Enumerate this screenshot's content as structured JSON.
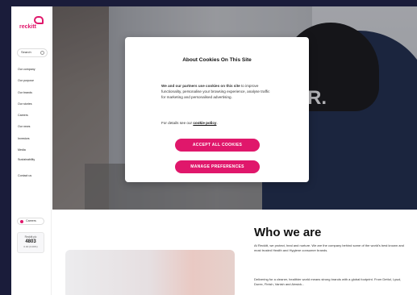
{
  "brand": {
    "name": "reckitt",
    "accent": "#e0176b"
  },
  "sidebar": {
    "search_label": "Search",
    "items": [
      {
        "label": "Our company"
      },
      {
        "label": "Our purpose"
      },
      {
        "label": "Our brands"
      },
      {
        "label": "Our stories"
      },
      {
        "label": "Careers"
      },
      {
        "label": "Our news"
      },
      {
        "label": "Investors"
      },
      {
        "label": "Media"
      },
      {
        "label": "Sustainability"
      },
      {
        "label": "Contact us"
      }
    ],
    "careers_label": "Careers",
    "stock": {
      "label": "Reckitt plc",
      "value": "4803",
      "change": "0.00 (0.00%)"
    }
  },
  "hero": {
    "headline": "ER."
  },
  "modal": {
    "title": "About Cookies On This Site",
    "body_bold": "We and our partners use cookies on this site",
    "body_rest": " to improve functionality, personalise your browsing experience, analyse traffic for marketing and personalised advertising.",
    "details_prefix": "For details see our ",
    "details_link": "cookie policy",
    "details_suffix": ".",
    "accept_label": "ACCEPT ALL COOKIES",
    "manage_label": "MANAGE PREFERENCES"
  },
  "about": {
    "title": "Who we are",
    "p1": "At Reckitt, we protect, heal and nurture. We are the company behind some of the world's best known and most trusted Health and Hygiene consumer brands.",
    "p2": "Delivering for a cleaner, healthier world means strong brands with a global footprint. From Dettol, Lysol, Durex, Finish, Vanish and Airwick..."
  }
}
